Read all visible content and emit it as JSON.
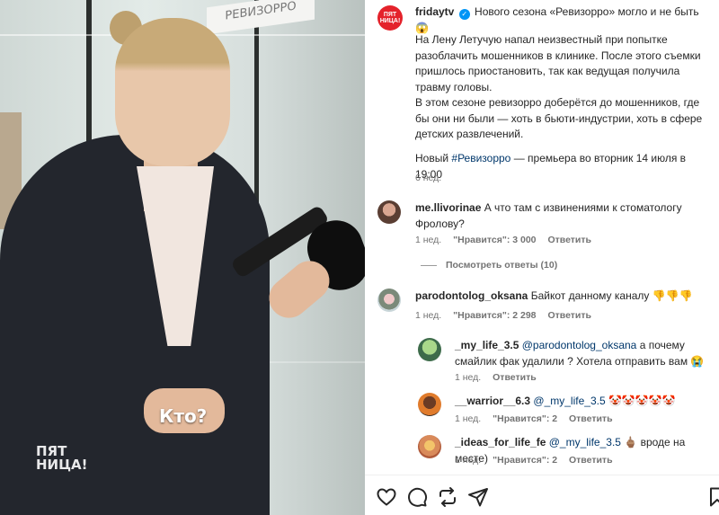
{
  "media": {
    "sign_text": "РЕВИЗОРРО",
    "caption": "Кто?",
    "watermark": "ПЯТ НИЦА!"
  },
  "post": {
    "author": "fridaytv",
    "author_avatar_text": "ПЯТ НИЦА!",
    "headline": "Нового сезона «Ревизорро» могло и не быть 😱",
    "paragraph1": "На Лену Летучую напал неизвестный при попытке разоблачить мошенников в клинике. После этого съемки пришлось приостановить, так как ведущая получила травму головы.",
    "paragraph2": "В этом сезоне ревизорро доберётся до мошенников, где бы они ни были — хоть в бьюти-индустрии, хоть в сфере детских развлечений.",
    "paragraph3_before": "Новый ",
    "paragraph3_tag": "#Ревизорро",
    "paragraph3_after": " — премьера во вторник 14 июля в 19:00",
    "time": "6 нед."
  },
  "comments": [
    {
      "user": "me.llivorinae",
      "text": "А что там с извинениями к стоматологу Фролову?",
      "time": "1 нед.",
      "likes": "\"Нравится\": 3 000",
      "reply": "Ответить",
      "view_replies": "Посмотреть ответы (10)"
    },
    {
      "user": "parodontolog_oksana",
      "text": "Байкот данному каналу",
      "emoji": [
        "👎",
        "👎",
        "👎"
      ],
      "time": "1 нед.",
      "likes": "\"Нравится\": 2 298",
      "reply": "Ответить"
    }
  ],
  "replies": [
    {
      "user": "_my_life_3.5",
      "mention": "@parodontolog_oksana",
      "text": " а почему смайлик фак удалили ? Хотела отправить вам 😭",
      "time": "1 нед.",
      "reply": "Ответить"
    },
    {
      "user": "__warrior__6.3",
      "mention": "@_my_life_3.5",
      "text": "🤡🤡🤡🤡🤡",
      "time": "1 нед.",
      "likes": "\"Нравится\": 2",
      "reply": "Ответить"
    },
    {
      "user": "_ideas_for_life_fe",
      "mention": "@_my_life_3.5",
      "text": " 🖕🏽 вроде на месте)",
      "time": "1 нед.",
      "likes": "\"Нравится\": 2",
      "reply": "Ответить"
    }
  ],
  "actions": [
    "heart-icon",
    "comment-icon",
    "repost-icon",
    "share-icon",
    "bookmark-icon"
  ],
  "colors": {
    "accent": "#0095f6",
    "link": "#00376b",
    "muted": "#737373",
    "brand": "#e4222b"
  }
}
